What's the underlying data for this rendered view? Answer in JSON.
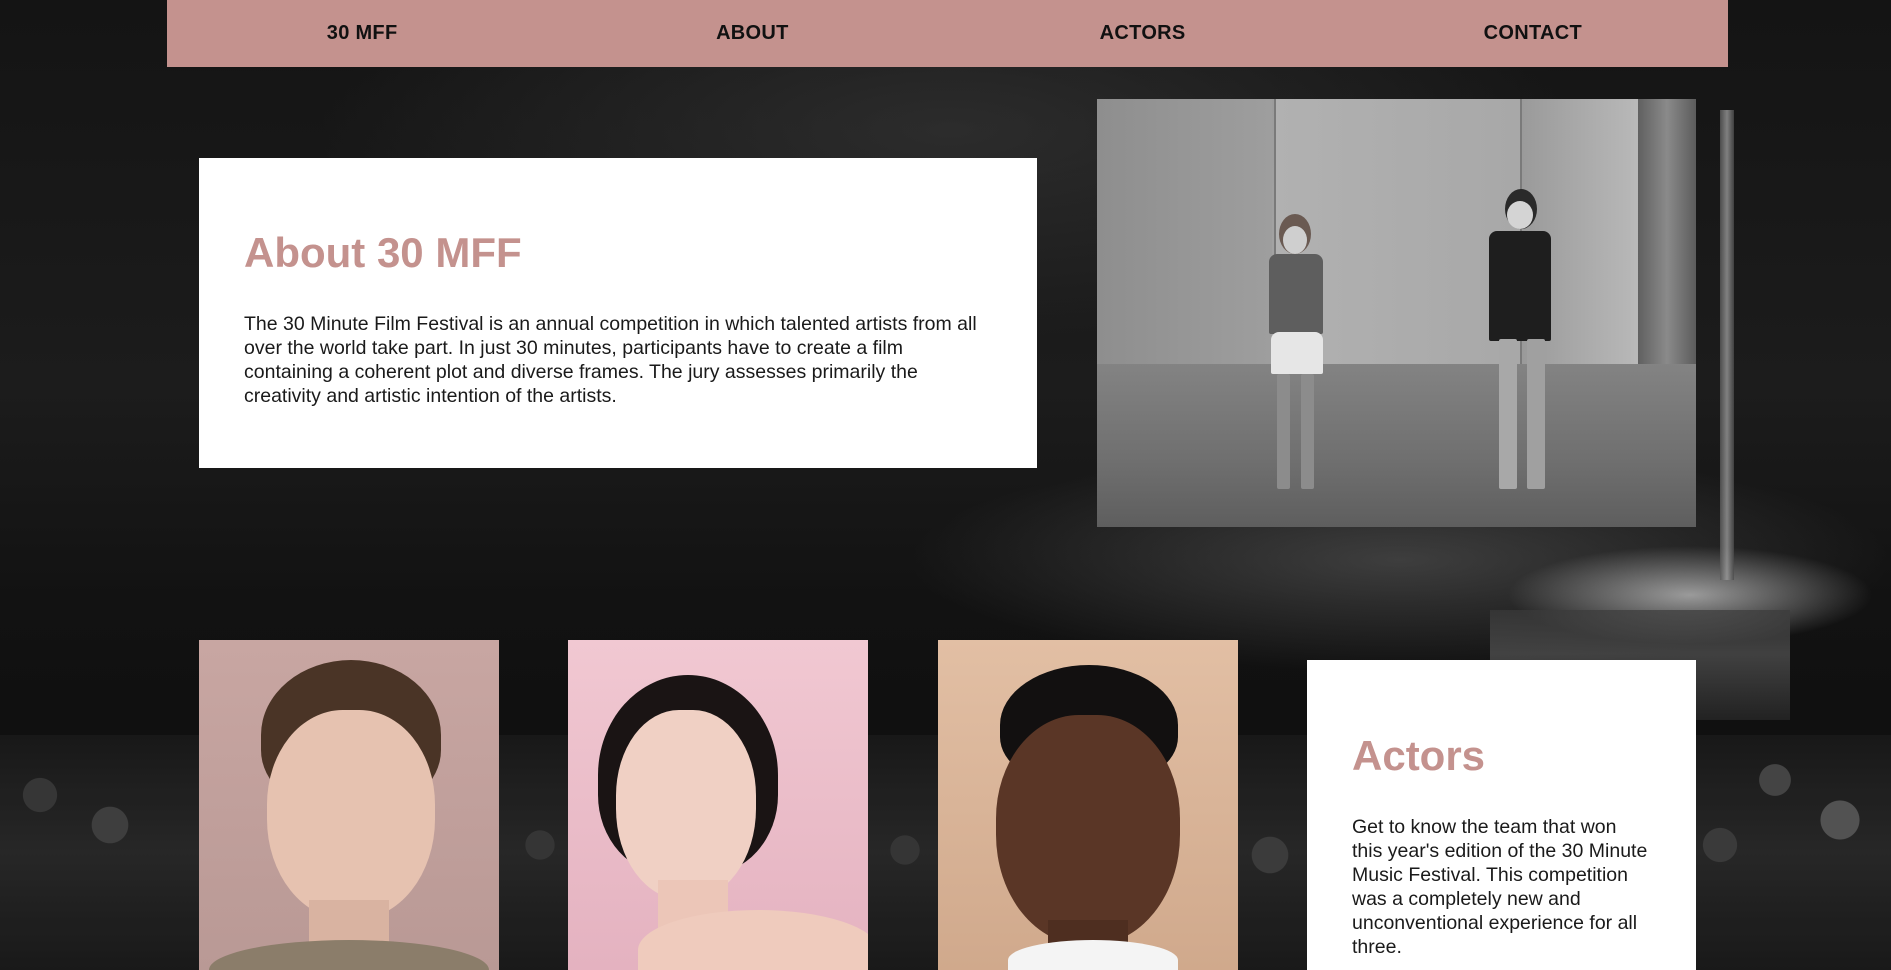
{
  "nav": {
    "items": [
      {
        "label": "30 MFF"
      },
      {
        "label": "ABOUT"
      },
      {
        "label": "ACTORS"
      },
      {
        "label": "CONTACT"
      }
    ]
  },
  "about": {
    "title": "About 30 MFF",
    "text": "The 30 Minute Film Festival is an annual competition in which talented artists from all over the world take part. In just 30 minutes, participants have to create a film containing a coherent plot and diverse frames. The jury assesses primarily the creativity and artistic intention of the artists."
  },
  "actors": {
    "title": "Actors",
    "text": "Get to know the team that won this year's edition of the 30 Minute Music Festival. This competition was a completely new and unconventional experience for all three."
  },
  "colors": {
    "accent": "#c4928e",
    "card_bg": "#ffffff",
    "text": "#1a1a1a",
    "page_bg": "#0a0a0a"
  }
}
